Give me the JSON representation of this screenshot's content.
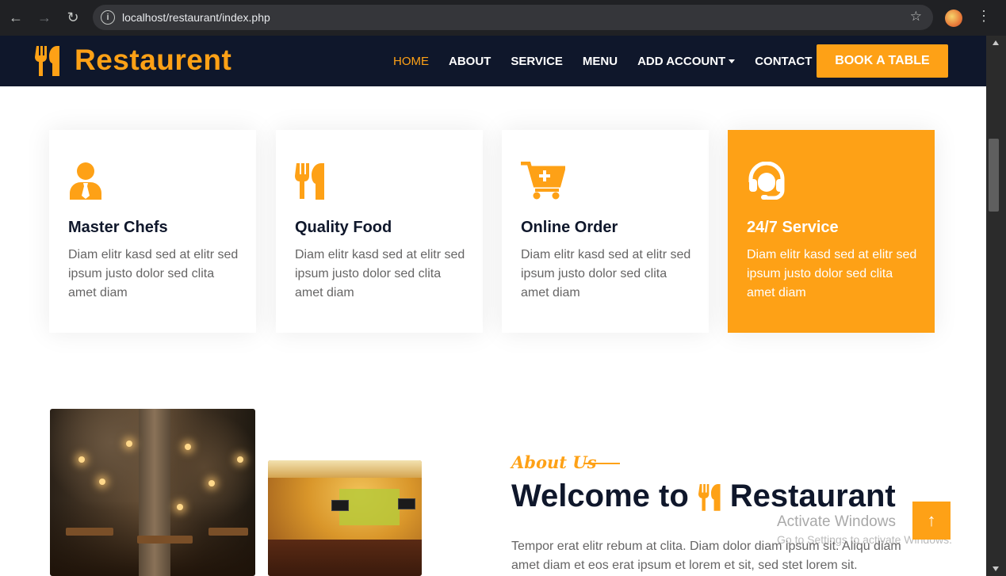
{
  "browser": {
    "url": "localhost/restaurant/index.php"
  },
  "brand": {
    "name": "Restaurent",
    "accent_color": "#fea116",
    "dark_color": "#0f172b"
  },
  "nav": {
    "items": [
      {
        "label": "HOME",
        "active": true
      },
      {
        "label": "ABOUT"
      },
      {
        "label": "SERVICE"
      },
      {
        "label": "MENU"
      },
      {
        "label": "ADD ACCOUNT",
        "dropdown": true
      },
      {
        "label": "CONTACT"
      }
    ],
    "cta": "BOOK A TABLE"
  },
  "services": [
    {
      "icon": "user-tie-icon",
      "title": "Master Chefs",
      "description": "Diam elitr kasd sed at elitr sed ipsum justo dolor sed clita amet diam"
    },
    {
      "icon": "utensils-icon",
      "title": "Quality Food",
      "description": "Diam elitr kasd sed at elitr sed ipsum justo dolor sed clita amet diam"
    },
    {
      "icon": "cart-plus-icon",
      "title": "Online Order",
      "description": "Diam elitr kasd sed at elitr sed ipsum justo dolor sed clita amet diam"
    },
    {
      "icon": "headset-icon",
      "title": "24/7 Service",
      "description": "Diam elitr kasd sed at elitr sed ipsum justo dolor sed clita amet diam",
      "featured": true
    }
  ],
  "about": {
    "subtitle": "About Us",
    "title_prefix": "Welcome to",
    "title_brand": "Restaurant",
    "text": "Tempor erat elitr rebum at clita. Diam dolor diam ipsum sit. Aliqu diam amet diam et eos erat ipsum et lorem et sit, sed stet lorem sit."
  },
  "watermark": {
    "line1": "Activate Windows",
    "line2": "Go to Settings to activate Windows."
  },
  "back_to_top": "↑"
}
